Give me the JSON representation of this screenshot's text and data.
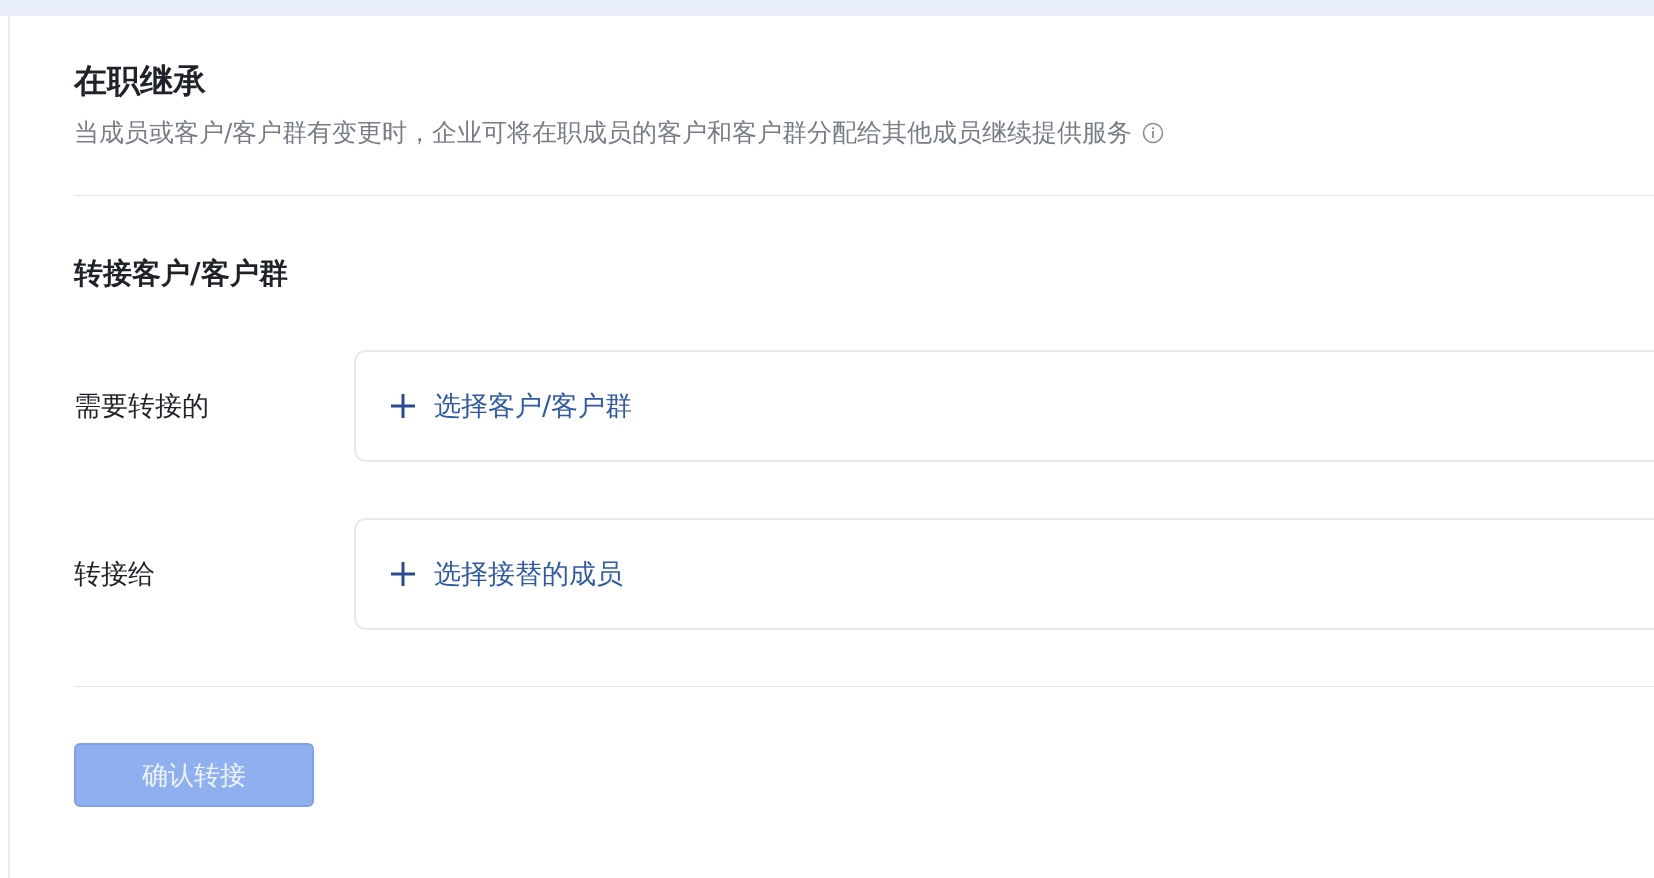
{
  "page": {
    "title": "在职继承",
    "description": "当成员或客户/客户群有变更时，企业可将在职成员的客户和客户群分配给其他成员继续提供服务"
  },
  "section": {
    "title": "转接客户/客户群",
    "fields": [
      {
        "label": "需要转接的",
        "action": "选择客户/客户群"
      },
      {
        "label": "转接给",
        "action": "选择接替的成员"
      }
    ]
  },
  "confirm_button": {
    "label": "确认转接",
    "disabled": true
  }
}
